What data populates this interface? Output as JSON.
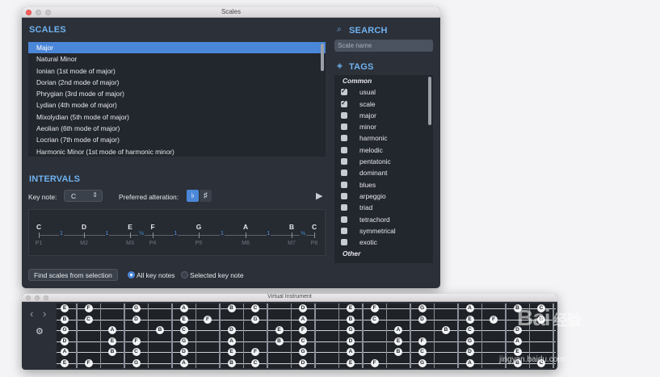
{
  "scales_window": {
    "title": "Scales",
    "scales_heading": "SCALES",
    "scales": [
      "Major",
      "Natural Minor",
      "Ionian (1st mode of major)",
      "Dorian (2nd mode of major)",
      "Phrygian (3rd mode of major)",
      "Lydian (4th mode of major)",
      "Mixolydian (5th mode of major)",
      "Aeolian (6th mode of major)",
      "Locrian (7th mode of major)",
      "Harmonic Minor (1st mode of harmonic minor)"
    ],
    "selected_scale_index": 0,
    "intervals_heading": "INTERVALS",
    "key_note_label": "Key note:",
    "key_note_value": "C",
    "preferred_alteration_label": "Preferred alteration:",
    "alteration_flat": "♭",
    "alteration_sharp": "♯",
    "interval_notes": [
      "C",
      "D",
      "E",
      "F",
      "G",
      "A",
      "B",
      "C"
    ],
    "interval_names": [
      "P1",
      "M2",
      "M3",
      "P4",
      "P5",
      "M6",
      "M7",
      "P8"
    ],
    "interval_steps": [
      "1",
      "1",
      "½",
      "1",
      "1",
      "1",
      "½"
    ],
    "find_button": "Find scales from selection",
    "radio_all": "All key notes",
    "radio_selected": "Selected key note",
    "search_heading": "SEARCH",
    "search_placeholder": "Scale name",
    "tags_heading": "TAGS",
    "tag_group_common": "Common",
    "tags": [
      {
        "label": "usual",
        "checked": true
      },
      {
        "label": "scale",
        "checked": true
      },
      {
        "label": "major",
        "checked": false
      },
      {
        "label": "minor",
        "checked": false
      },
      {
        "label": "harmonic",
        "checked": false
      },
      {
        "label": "melodic",
        "checked": false
      },
      {
        "label": "pentatonic",
        "checked": false
      },
      {
        "label": "dominant",
        "checked": false
      },
      {
        "label": "blues",
        "checked": false
      },
      {
        "label": "arpeggio",
        "checked": false
      },
      {
        "label": "triad",
        "checked": false
      },
      {
        "label": "tetrachord",
        "checked": false
      },
      {
        "label": "symmetrical",
        "checked": false
      },
      {
        "label": "exotic",
        "checked": false
      }
    ],
    "tag_group_other": "Other"
  },
  "instrument_window": {
    "title": "Virtual Instrument",
    "fret_notes": [
      {
        "string": 0,
        "fret": 0,
        "note": "E"
      },
      {
        "string": 0,
        "fret": 1,
        "note": "F"
      },
      {
        "string": 0,
        "fret": 3,
        "note": "G"
      },
      {
        "string": 0,
        "fret": 5,
        "note": "A"
      },
      {
        "string": 0,
        "fret": 7,
        "note": "B"
      },
      {
        "string": 0,
        "fret": 8,
        "note": "C"
      },
      {
        "string": 0,
        "fret": 10,
        "note": "D"
      },
      {
        "string": 0,
        "fret": 12,
        "note": "E"
      },
      {
        "string": 0,
        "fret": 13,
        "note": "F"
      },
      {
        "string": 0,
        "fret": 15,
        "note": "G"
      },
      {
        "string": 0,
        "fret": 17,
        "note": "A"
      },
      {
        "string": 0,
        "fret": 19,
        "note": "B"
      },
      {
        "string": 0,
        "fret": 20,
        "note": "C"
      },
      {
        "string": 1,
        "fret": 0,
        "note": "B"
      },
      {
        "string": 1,
        "fret": 1,
        "note": "C"
      },
      {
        "string": 1,
        "fret": 3,
        "note": "D"
      },
      {
        "string": 1,
        "fret": 5,
        "note": "E"
      },
      {
        "string": 1,
        "fret": 6,
        "note": "F"
      },
      {
        "string": 1,
        "fret": 8,
        "note": "G"
      },
      {
        "string": 1,
        "fret": 10,
        "note": "A"
      },
      {
        "string": 1,
        "fret": 12,
        "note": "B"
      },
      {
        "string": 1,
        "fret": 13,
        "note": "C"
      },
      {
        "string": 1,
        "fret": 15,
        "note": "D"
      },
      {
        "string": 1,
        "fret": 17,
        "note": "E"
      },
      {
        "string": 1,
        "fret": 18,
        "note": "F"
      },
      {
        "string": 1,
        "fret": 20,
        "note": "G"
      },
      {
        "string": 2,
        "fret": 0,
        "note": "G"
      },
      {
        "string": 2,
        "fret": 2,
        "note": "A"
      },
      {
        "string": 2,
        "fret": 4,
        "note": "B"
      },
      {
        "string": 2,
        "fret": 5,
        "note": "C"
      },
      {
        "string": 2,
        "fret": 7,
        "note": "D"
      },
      {
        "string": 2,
        "fret": 9,
        "note": "E"
      },
      {
        "string": 2,
        "fret": 10,
        "note": "F"
      },
      {
        "string": 2,
        "fret": 12,
        "note": "G"
      },
      {
        "string": 2,
        "fret": 14,
        "note": "A"
      },
      {
        "string": 2,
        "fret": 16,
        "note": "B"
      },
      {
        "string": 2,
        "fret": 17,
        "note": "C"
      },
      {
        "string": 2,
        "fret": 19,
        "note": "D"
      },
      {
        "string": 3,
        "fret": 0,
        "note": "D"
      },
      {
        "string": 3,
        "fret": 2,
        "note": "E"
      },
      {
        "string": 3,
        "fret": 3,
        "note": "F"
      },
      {
        "string": 3,
        "fret": 5,
        "note": "G"
      },
      {
        "string": 3,
        "fret": 7,
        "note": "A"
      },
      {
        "string": 3,
        "fret": 9,
        "note": "B"
      },
      {
        "string": 3,
        "fret": 10,
        "note": "C"
      },
      {
        "string": 3,
        "fret": 12,
        "note": "D"
      },
      {
        "string": 3,
        "fret": 14,
        "note": "E"
      },
      {
        "string": 3,
        "fret": 15,
        "note": "F"
      },
      {
        "string": 3,
        "fret": 17,
        "note": "G"
      },
      {
        "string": 3,
        "fret": 19,
        "note": "A"
      },
      {
        "string": 4,
        "fret": 0,
        "note": "A"
      },
      {
        "string": 4,
        "fret": 2,
        "note": "B"
      },
      {
        "string": 4,
        "fret": 3,
        "note": "C"
      },
      {
        "string": 4,
        "fret": 5,
        "note": "D"
      },
      {
        "string": 4,
        "fret": 7,
        "note": "E"
      },
      {
        "string": 4,
        "fret": 8,
        "note": "F"
      },
      {
        "string": 4,
        "fret": 10,
        "note": "G"
      },
      {
        "string": 4,
        "fret": 12,
        "note": "A"
      },
      {
        "string": 4,
        "fret": 14,
        "note": "B"
      },
      {
        "string": 4,
        "fret": 15,
        "note": "C"
      },
      {
        "string": 4,
        "fret": 17,
        "note": "D"
      },
      {
        "string": 4,
        "fret": 19,
        "note": "E"
      },
      {
        "string": 5,
        "fret": 0,
        "note": "E"
      },
      {
        "string": 5,
        "fret": 1,
        "note": "F"
      },
      {
        "string": 5,
        "fret": 3,
        "note": "G"
      },
      {
        "string": 5,
        "fret": 5,
        "note": "A"
      },
      {
        "string": 5,
        "fret": 7,
        "note": "B"
      },
      {
        "string": 5,
        "fret": 8,
        "note": "C"
      },
      {
        "string": 5,
        "fret": 10,
        "note": "D"
      },
      {
        "string": 5,
        "fret": 12,
        "note": "E"
      },
      {
        "string": 5,
        "fret": 13,
        "note": "F"
      },
      {
        "string": 5,
        "fret": 15,
        "note": "G"
      },
      {
        "string": 5,
        "fret": 17,
        "note": "A"
      },
      {
        "string": 5,
        "fret": 19,
        "note": "B"
      },
      {
        "string": 5,
        "fret": 20,
        "note": "C"
      }
    ]
  },
  "watermark": {
    "text": "Bai 经验",
    "url": "jingyan.baidu.com"
  },
  "colors": {
    "accent": "#4b87d8",
    "heading": "#6fb2f0",
    "window_bg": "#2c3038"
  }
}
